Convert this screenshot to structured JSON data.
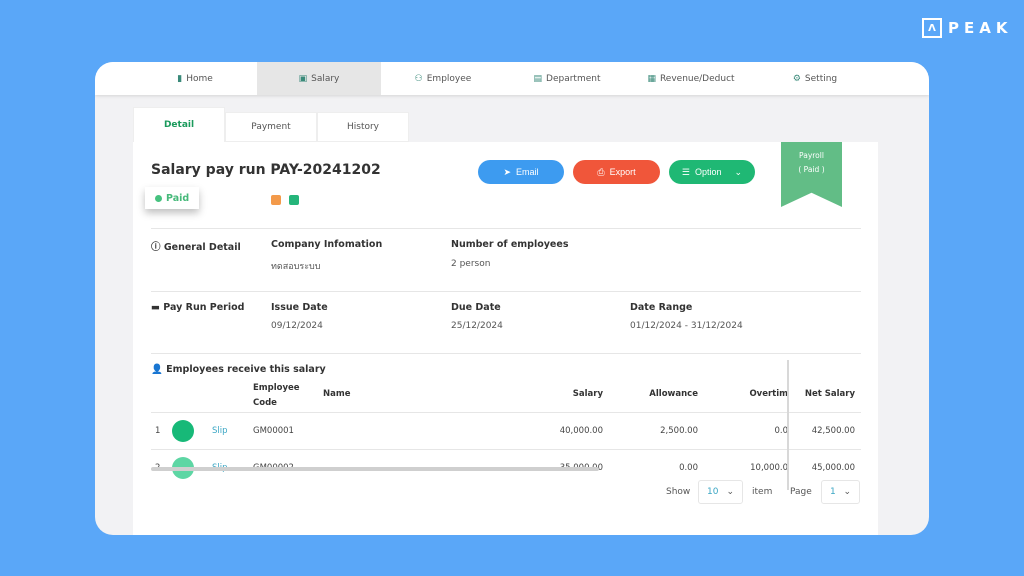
{
  "brand": {
    "name": "PEAK"
  },
  "nav": [
    {
      "label": "Home",
      "icon": "chart-icon"
    },
    {
      "label": "Salary",
      "icon": "salary-icon",
      "active": true
    },
    {
      "label": "Employee",
      "icon": "users-icon"
    },
    {
      "label": "Department",
      "icon": "department-icon"
    },
    {
      "label": "Revenue/Deduct",
      "icon": "revenue-icon"
    },
    {
      "label": "Setting",
      "icon": "gear-icon"
    }
  ],
  "tabs": [
    {
      "label": "Detail",
      "active": true
    },
    {
      "label": "Payment"
    },
    {
      "label": "History"
    }
  ],
  "header": {
    "title": "Salary pay run PAY-20241202",
    "status": "Paid",
    "ribbon_line1": "Payroll",
    "ribbon_line2": "( Paid )"
  },
  "buttons": {
    "email": "Email",
    "export": "Export",
    "option": "Option"
  },
  "colors": {
    "email": "#3d9bf0",
    "export": "#f0563a",
    "option": "#1fb874",
    "paid": "#46c27f",
    "ribbon": "#62bd86"
  },
  "general": {
    "title": "General Detail",
    "company_label": "Company Infomation",
    "company_value": "ทดสอบระบบ",
    "employees_label": "Number of employees",
    "employees_value": "2 person"
  },
  "period": {
    "title": "Pay Run Period",
    "issue_label": "Issue Date",
    "issue_value": "09/12/2024",
    "due_label": "Due Date",
    "due_value": "25/12/2024",
    "range_label": "Date Range",
    "range_value": "01/12/2024 - 31/12/2024"
  },
  "employees": {
    "title": "Employees receive this salary",
    "columns": {
      "code1": "Employee",
      "code2": "Code",
      "name": "Name",
      "salary": "Salary",
      "allowance": "Allowance",
      "overtime": "Overtim",
      "net": "Net Salary"
    },
    "rows": [
      {
        "no": "1",
        "slip": "Slip",
        "code": "GM00001",
        "name": "",
        "salary": "40,000.00",
        "allowance": "2,500.00",
        "overtime": "0.0",
        "net": "42,500.00",
        "color": "#17b978"
      },
      {
        "no": "2",
        "slip": "Slip",
        "code": "GM00002",
        "name": "",
        "salary": "35,000.00",
        "allowance": "0.00",
        "overtime": "10,000.0",
        "net": "45,000.00",
        "color": "#5dd6a4"
      }
    ]
  },
  "pagination": {
    "show_label": "Show",
    "show_value": "10",
    "item_label": "item",
    "page_label": "Page",
    "page_value": "1"
  }
}
